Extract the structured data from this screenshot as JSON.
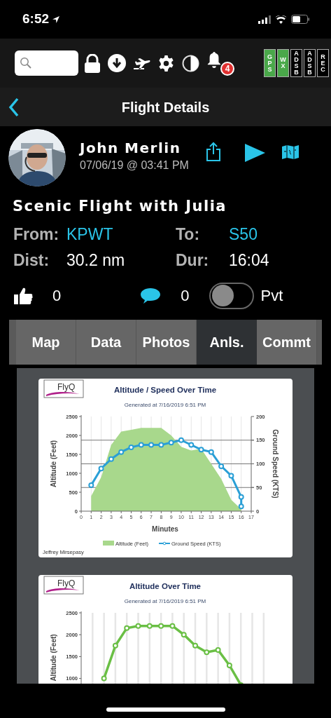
{
  "status_bar": {
    "time": "6:52"
  },
  "toolbar": {
    "notifications": "4",
    "indicators": [
      {
        "label": "GPS",
        "on": true
      },
      {
        "label": "WX",
        "on": true
      },
      {
        "label": "ADSB",
        "on": false
      },
      {
        "label": "ADSB",
        "on": false
      },
      {
        "label": "REC",
        "on": false
      }
    ]
  },
  "nav": {
    "title": "Flight Details"
  },
  "flight": {
    "pilot": "John Merlin",
    "date": "07/06/19 @ 03:41 PM",
    "title": "Scenic Flight with Julia",
    "fields": [
      {
        "label": "From:",
        "value": "KPWT",
        "kind": "link"
      },
      {
        "label": "To:",
        "value": "S50",
        "kind": "link"
      },
      {
        "label": "Dist:",
        "value": "30.2 nm",
        "kind": "plain"
      },
      {
        "label": "Dur:",
        "value": "16:04",
        "kind": "plain"
      }
    ],
    "likes": "0",
    "comments": "0",
    "private": {
      "label": "Pvt",
      "on": false
    }
  },
  "tabs": [
    {
      "label": "Map",
      "selected": false
    },
    {
      "label": "Data",
      "selected": false
    },
    {
      "label": "Photos",
      "selected": false
    },
    {
      "label": "Anls.",
      "selected": true
    },
    {
      "label": "Commt",
      "selected": false
    }
  ],
  "reports": [
    {
      "logo": "FlyQ",
      "subtitle": "Generated at 7/16/2019 6:51 PM",
      "footer": "Jeffrey Mirsepasy",
      "chart_data": {
        "type": "area",
        "grid": true,
        "legend": "bottom",
        "title": "Altitude / Speed Over Time",
        "xlabel": "Minutes",
        "ylabel": "Altitude (Feet)",
        "y2label": "Ground Speed (KTS)",
        "xlim": [
          0,
          17
        ],
        "ylim": [
          0,
          2500
        ],
        "y2lim": [
          0,
          200
        ],
        "xticks": [
          0,
          1,
          2,
          3,
          4,
          5,
          6,
          7,
          8,
          9,
          10,
          11,
          12,
          13,
          14,
          15,
          16,
          17
        ],
        "yticks": [
          0,
          500,
          1000,
          1500,
          2000,
          2500
        ],
        "y2ticks": [
          0,
          50,
          100,
          150,
          200
        ],
        "series": [
          {
            "name": "Altitude (Feet)",
            "type": "area",
            "color": "#a8d88c",
            "x": [
              1,
              2,
              3,
              4,
              5,
              6,
              7,
              8,
              9,
              10,
              11,
              12,
              13,
              14,
              15,
              16
            ],
            "values": [
              400,
              900,
              1750,
              2100,
              2150,
              2200,
              2200,
              2200,
              2000,
              1700,
              1600,
              1650,
              1250,
              850,
              300,
              50
            ]
          },
          {
            "name": "Ground Speed (KTS)",
            "type": "line",
            "marker": true,
            "axis": "y2",
            "color": "#2a9fd6",
            "x": [
              1,
              2,
              3,
              4,
              5,
              6,
              7,
              8,
              9,
              10,
              11,
              12,
              13,
              14,
              15,
              16,
              16
            ],
            "values": [
              55,
              90,
              110,
              125,
              135,
              140,
              140,
              140,
              145,
              150,
              140,
              130,
              125,
              95,
              75,
              30,
              10
            ]
          }
        ]
      }
    },
    {
      "logo": "FlyQ",
      "subtitle": "Generated at 7/16/2019 6:51 PM",
      "chart_data": {
        "type": "line",
        "grid": true,
        "title": "Altitude Over Time",
        "ylabel": "Altitude (Feet)",
        "ylim": [
          0,
          2500
        ],
        "yticks": [
          1000,
          1500,
          2000,
          2500
        ],
        "categories": [
          null,
          null,
          null,
          null,
          null,
          null,
          null,
          null,
          null,
          null,
          null,
          null,
          null
        ],
        "series": [
          {
            "type": "line",
            "marker": true,
            "color": "#6abf45",
            "values": [
              1000,
              1750,
              2150,
              2200,
              2200,
              2200,
              2200,
              2000,
              1750,
              1600,
              1650,
              1300,
              850
            ]
          }
        ]
      }
    }
  ]
}
